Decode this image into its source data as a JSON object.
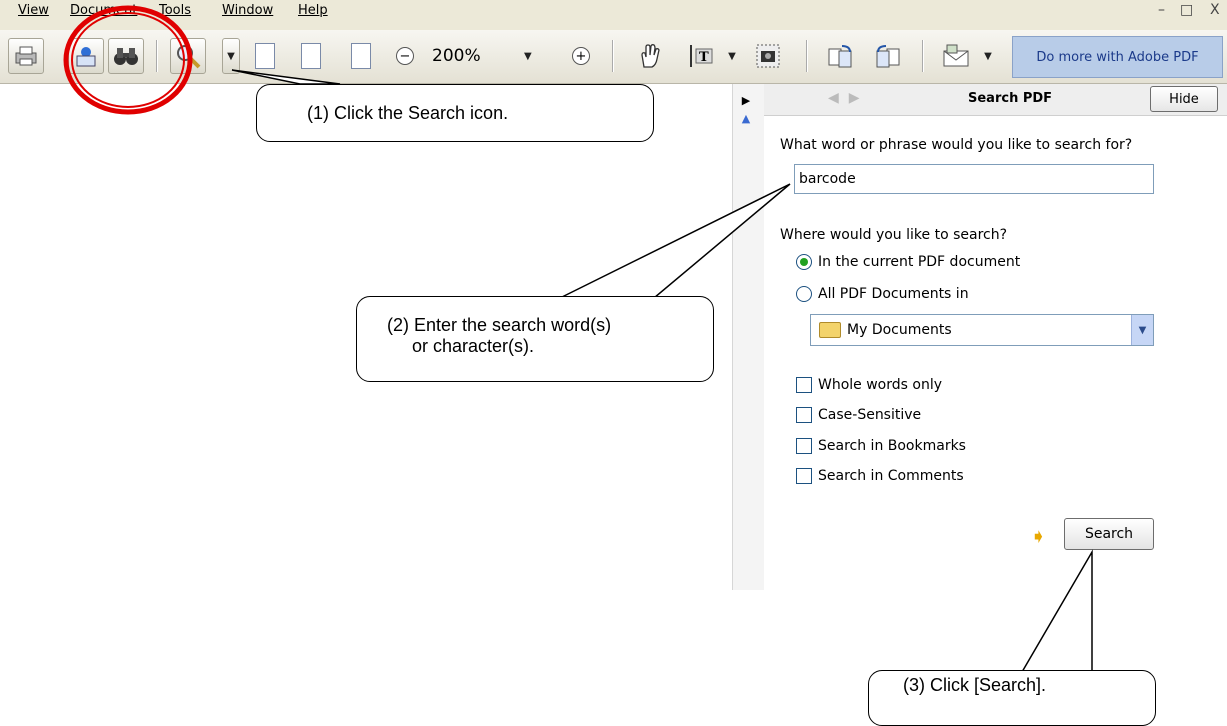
{
  "menu": {
    "items": [
      "View",
      "Document",
      "Tools",
      "Window",
      "Help"
    ],
    "window_controls": [
      "–",
      "□",
      "X"
    ]
  },
  "toolbar": {
    "zoom_value": "200%",
    "do_more_label": "Do more with Adobe PDF"
  },
  "search_pane": {
    "title": "Search PDF",
    "hide_label": "Hide",
    "question_label": "What word or phrase would you like to search for?",
    "search_value": "barcode",
    "where_label": "Where would you like to search?",
    "radio_options": [
      {
        "label": "In the current PDF document",
        "selected": true
      },
      {
        "label": "All PDF Documents in",
        "selected": false
      }
    ],
    "location_value": "My Documents",
    "checkboxes": [
      {
        "label": "Whole words only",
        "checked": false
      },
      {
        "label": "Case-Sensitive",
        "checked": false
      },
      {
        "label": "Search in Bookmarks",
        "checked": false
      },
      {
        "label": "Search in Comments",
        "checked": false
      }
    ],
    "search_button_label": "Search"
  },
  "callouts": {
    "step1": "(1) Click the Search icon.",
    "step2": "(2) Enter the search word(s)\n     or character(s).",
    "step3": "(3) Click [Search]."
  },
  "colors": {
    "highlight_ring": "#e00000",
    "accent_button": "#b8cce8",
    "radio_selected": "#21a121"
  }
}
